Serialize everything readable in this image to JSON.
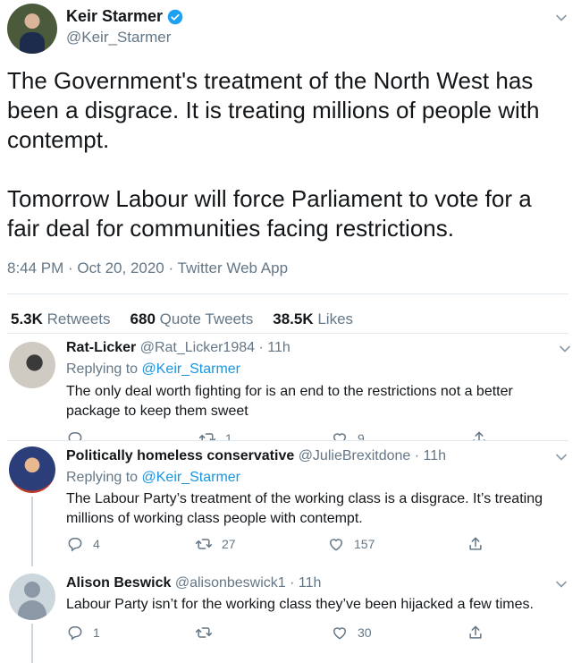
{
  "main_tweet": {
    "display_name": "Keir Starmer",
    "handle": "@Keir_Starmer",
    "text": "The Government's treatment of the North West has been a disgrace. It is treating millions of people with contempt.\n\nTomorrow Labour will force Parliament to vote for a fair deal for communities facing restrictions.",
    "timestamp": "8:44 PM · Oct 20, 2020 · Twitter Web App",
    "stats": [
      {
        "count": "5.3K",
        "label": "Retweets"
      },
      {
        "count": "680",
        "label": "Quote Tweets"
      },
      {
        "count": "38.5K",
        "label": "Likes"
      }
    ],
    "verified_color": "#1da1f2"
  },
  "replies": [
    {
      "display_name": "Rat-Licker",
      "handle": "@Rat_Licker1984 · 11h",
      "replying_prefix": "Replying to ",
      "replying_to": "@Keir_Starmer",
      "text": "The only deal worth fighting for is an end to the restrictions not a better package to keep them sweet",
      "reply_count": "",
      "retweet_count": "1",
      "like_count": "9"
    },
    {
      "display_name": "Politically homeless conservative",
      "handle": "@JulieBrexitdone · 11h",
      "replying_prefix": "Replying to ",
      "replying_to": "@Keir_Starmer",
      "text": "The Labour Party’s treatment of the working class is a disgrace. It’s treating millions of working class people with contempt.",
      "reply_count": "4",
      "retweet_count": "27",
      "like_count": "157"
    },
    {
      "display_name": "Alison Beswick",
      "handle": "@alisonbeswick1 · 11h",
      "text": "Labour Party isn’t for the working class they’ve been hijacked a few times.",
      "reply_count": "1",
      "retweet_count": "",
      "like_count": "30"
    }
  ],
  "icons": {
    "more": "chevron-down-icon",
    "reply": "reply-icon",
    "retweet": "retweet-icon",
    "like": "heart-icon",
    "share": "share-icon"
  },
  "colors": {
    "accent": "#1b95e0",
    "muted": "#657786",
    "text": "#14171a",
    "divider": "#e1e8ed"
  }
}
